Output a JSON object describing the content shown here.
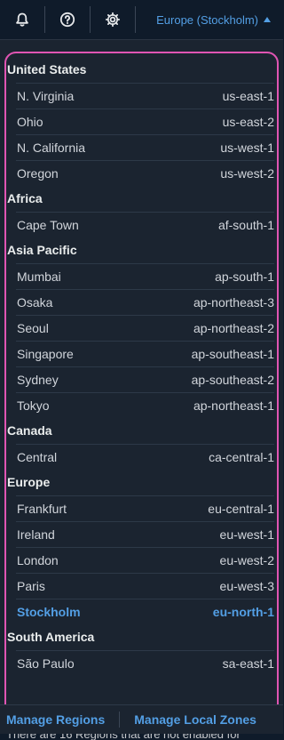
{
  "topbar": {
    "icons": [
      "bell-icon",
      "help-icon",
      "gear-icon"
    ],
    "region_label": "Europe (Stockholm)"
  },
  "groups": [
    {
      "title": "United States",
      "regions": [
        {
          "name": "N. Virginia",
          "code": "us-east-1"
        },
        {
          "name": "Ohio",
          "code": "us-east-2"
        },
        {
          "name": "N. California",
          "code": "us-west-1"
        },
        {
          "name": "Oregon",
          "code": "us-west-2"
        }
      ]
    },
    {
      "title": "Africa",
      "regions": [
        {
          "name": "Cape Town",
          "code": "af-south-1"
        }
      ]
    },
    {
      "title": "Asia Pacific",
      "regions": [
        {
          "name": "Mumbai",
          "code": "ap-south-1"
        },
        {
          "name": "Osaka",
          "code": "ap-northeast-3"
        },
        {
          "name": "Seoul",
          "code": "ap-northeast-2"
        },
        {
          "name": "Singapore",
          "code": "ap-southeast-1"
        },
        {
          "name": "Sydney",
          "code": "ap-southeast-2"
        },
        {
          "name": "Tokyo",
          "code": "ap-northeast-1"
        }
      ]
    },
    {
      "title": "Canada",
      "regions": [
        {
          "name": "Central",
          "code": "ca-central-1"
        }
      ]
    },
    {
      "title": "Europe",
      "regions": [
        {
          "name": "Frankfurt",
          "code": "eu-central-1"
        },
        {
          "name": "Ireland",
          "code": "eu-west-1"
        },
        {
          "name": "London",
          "code": "eu-west-2"
        },
        {
          "name": "Paris",
          "code": "eu-west-3"
        },
        {
          "name": "Stockholm",
          "code": "eu-north-1",
          "selected": true
        }
      ]
    },
    {
      "title": "South America",
      "regions": [
        {
          "name": "São Paulo",
          "code": "sa-east-1"
        }
      ]
    }
  ],
  "hint_text": "There are 16 Regions that are not enabled for",
  "footer": {
    "manage_regions": "Manage Regions",
    "manage_local_zones": "Manage Local Zones"
  },
  "colors": {
    "accent": "#539fe5",
    "highlight_border": "#e055b3"
  }
}
